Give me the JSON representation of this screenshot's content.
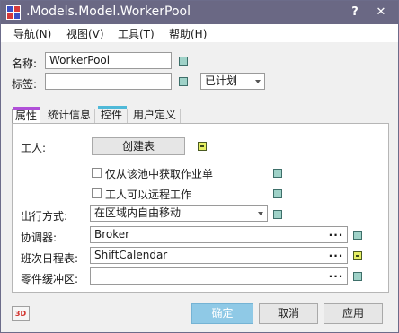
{
  "window": {
    "title": ".Models.Model.WorkerPool",
    "help_glyph": "?",
    "close_glyph": "✕"
  },
  "menu": [
    "导航(N)",
    "视图(V)",
    "工具(T)",
    "帮助(H)"
  ],
  "header": {
    "name_label": "名称:",
    "name_value": "WorkerPool",
    "tag_label": "标签:",
    "tag_value": "",
    "status_value": "已计划"
  },
  "tabs": [
    {
      "label": "属性",
      "accent": "#b050d8",
      "active": true
    },
    {
      "label": "统计信息",
      "accent": "#f0f0f0",
      "active": false
    },
    {
      "label": "控件",
      "accent": "#4fb9d8",
      "active": false
    },
    {
      "label": "用户定义",
      "accent": "#f0f0f0",
      "active": false
    }
  ],
  "properties": {
    "workers_label": "工人:",
    "create_table_button": "创建表",
    "only_from_pool_label": "仅从该池中获取作业单",
    "only_from_pool_checked": false,
    "remote_work_label": "工人可以远程工作",
    "remote_work_checked": false,
    "travel_mode_label": "出行方式:",
    "travel_mode_value": "在区域内自由移动",
    "coordinator_label": "协调器:",
    "coordinator_value": "Broker",
    "shift_calendar_label": "班次日程表:",
    "shift_calendar_value": "ShiftCalendar",
    "parts_buffer_label": "零件缓冲区:",
    "parts_buffer_value": "",
    "browse_glyph": "..."
  },
  "footer": {
    "three_d_label": "3D",
    "ok_label": "确定",
    "cancel_label": "取消",
    "apply_label": "应用"
  },
  "colors": {
    "titlebar": "#6a6884",
    "inherit_square": "#9fd2c8",
    "link_square": "#e6ef64",
    "primary_button": "#8fc9e6"
  },
  "icons": {
    "app": "model-grid-icon",
    "inherit": "inheritance-square-icon",
    "link": "link-square-icon"
  }
}
